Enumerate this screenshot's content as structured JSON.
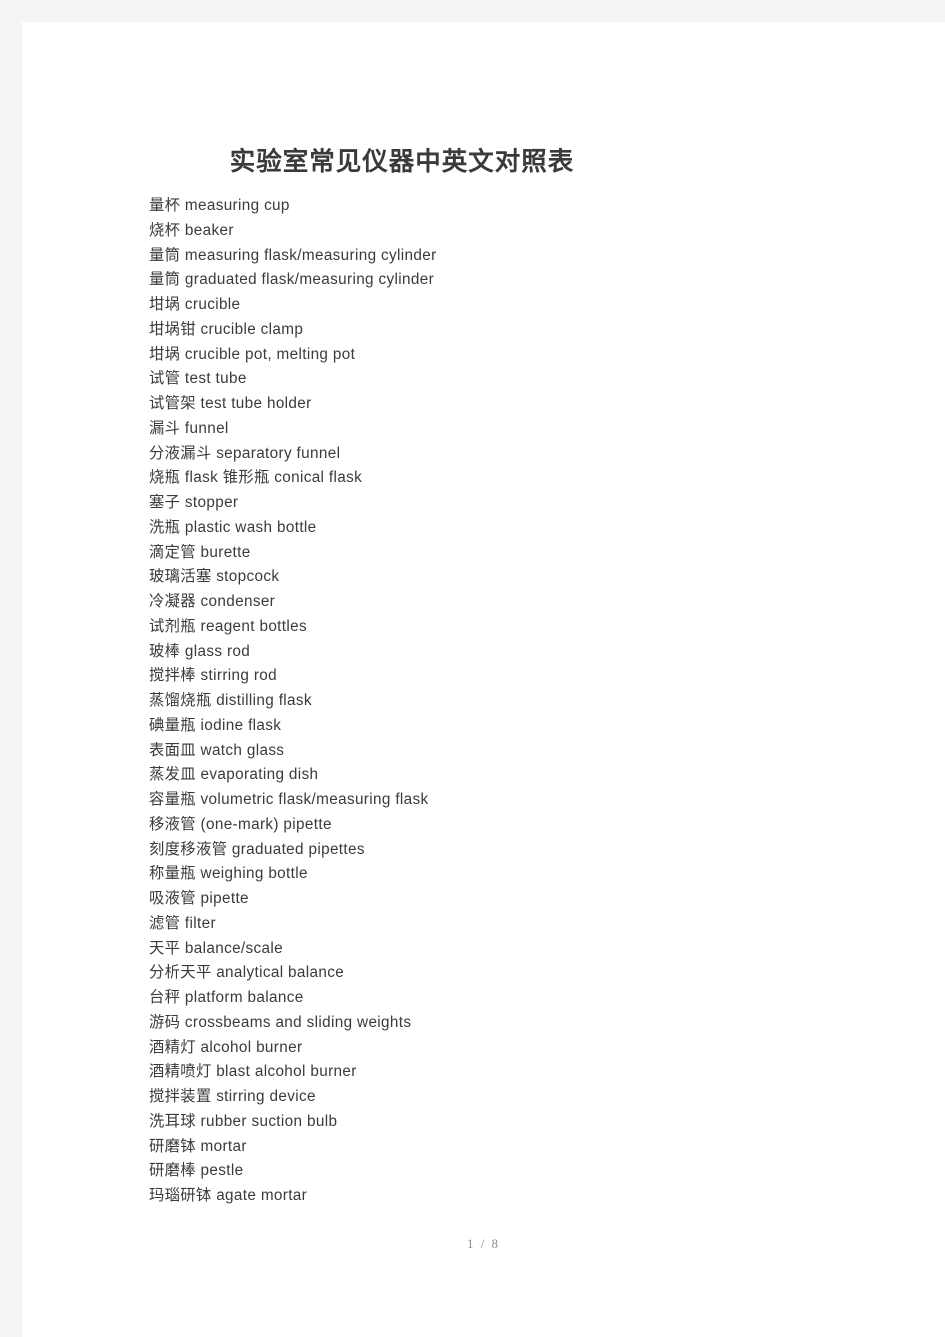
{
  "document": {
    "title": "实验室常见仪器中英文对照表",
    "page_indicator": "1 / 8",
    "colors": {
      "page_background": "#ffffff",
      "gutter_background": "#f4f4f4",
      "body_text": "#3b3b3b",
      "title_text": "#3a3a3a",
      "footer_text": "#8d8d8d"
    }
  },
  "glossary": {
    "entries": [
      "量杯 measuring cup",
      "烧杯 beaker",
      "量筒 measuring flask/measuring cylinder",
      "量筒 graduated flask/measuring cylinder",
      "坩埚 crucible",
      "坩埚钳 crucible clamp",
      "坩埚 crucible pot, melting pot",
      "试管 test tube",
      "试管架 test tube holder",
      "漏斗 funnel",
      "分液漏斗 separatory funnel",
      "烧瓶 flask 锥形瓶 conical flask",
      "塞子 stopper",
      "洗瓶 plastic wash bottle",
      "滴定管 burette",
      "玻璃活塞 stopcock",
      "冷凝器 condenser",
      "试剂瓶 reagent bottles",
      "玻棒 glass rod",
      "搅拌棒 stirring rod",
      "蒸馏烧瓶 distilling flask",
      "碘量瓶 iodine flask",
      "表面皿 watch glass",
      "蒸发皿 evaporating dish",
      "容量瓶 volumetric flask/measuring flask",
      "移液管 (one-mark) pipette",
      "刻度移液管 graduated pipettes",
      "称量瓶 weighing bottle",
      "吸液管 pipette",
      "滤管 filter",
      "天平 balance/scale",
      "分析天平 analytical balance",
      "台秤 platform balance",
      "游码 crossbeams and sliding weights",
      "酒精灯 alcohol burner",
      "酒精喷灯 blast alcohol burner",
      "搅拌装置 stirring device",
      "洗耳球 rubber suction bulb",
      "研磨钵 mortar",
      "研磨棒 pestle",
      "玛瑙研钵 agate mortar"
    ]
  }
}
